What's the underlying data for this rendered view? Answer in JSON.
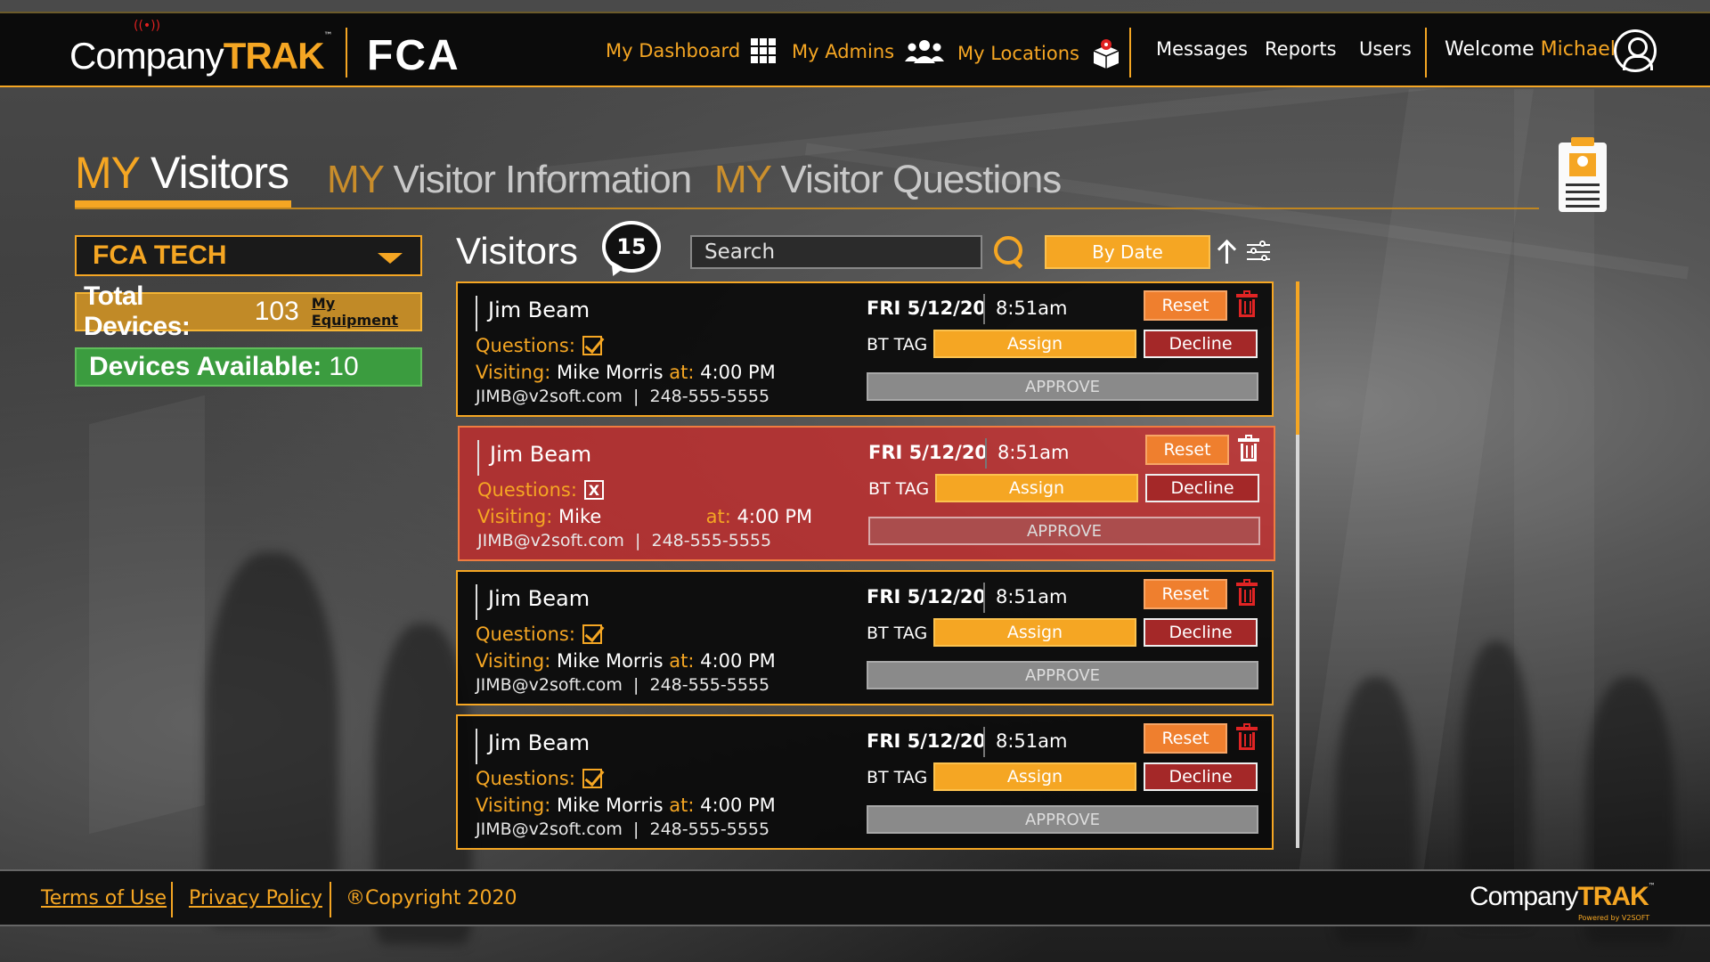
{
  "brand": {
    "company": "Company",
    "trak": "TRAK",
    "tm": "™",
    "client": "FCA"
  },
  "nav": {
    "dashboard": "My Dashboard",
    "admins": "My Admins",
    "locations": "My Locations",
    "messages": "Messages",
    "reports": "Reports",
    "users": "Users",
    "welcome": "Welcome",
    "user_name": "Michael"
  },
  "tabs": [
    {
      "my": "MY",
      "rest": " Visitors"
    },
    {
      "my": "MY",
      "rest": " Visitor Information"
    },
    {
      "my": "MY",
      "rest": " Visitor Questions"
    }
  ],
  "sidebar": {
    "location": "FCA TECH",
    "total_label": "Total Devices:",
    "total_value": "103",
    "equipment_link": "My Equipment",
    "available_label": "Devices Available:",
    "available_value": "10"
  },
  "list": {
    "title": "Visitors",
    "count": "15",
    "search_placeholder": "Search",
    "sort_label": "By Date"
  },
  "labels": {
    "questions": "Questions:",
    "visiting": "Visiting:",
    "at": "at:",
    "bt_tag": "BT TAG",
    "reset": "Reset",
    "assign": "Assign",
    "decline": "Decline",
    "approve": "APPROVE",
    "x_mark": "X"
  },
  "visitors": [
    {
      "name": "Jim Beam",
      "questions_ok": true,
      "host": "Mike Morris",
      "time": "4:00 PM",
      "email": "JIMB@v2soft.com",
      "phone": "248-555-5555",
      "date": "FRI 5/12/20",
      "checkin": "8:51am",
      "alert": false
    },
    {
      "name": "Jim Beam",
      "questions_ok": false,
      "host": "Mike",
      "time": "4:00 PM",
      "email": "JIMB@v2soft.com",
      "phone": "248-555-5555",
      "date": "FRI 5/12/20",
      "checkin": "8:51am",
      "alert": true
    },
    {
      "name": "Jim Beam",
      "questions_ok": true,
      "host": "Mike Morris",
      "time": "4:00 PM",
      "email": "JIMB@v2soft.com",
      "phone": "248-555-5555",
      "date": "FRI 5/12/20",
      "checkin": "8:51am",
      "alert": false
    },
    {
      "name": "Jim Beam",
      "questions_ok": true,
      "host": "Mike Morris",
      "time": "4:00 PM",
      "email": "JIMB@v2soft.com",
      "phone": "248-555-5555",
      "date": "FRI 5/12/20",
      "checkin": "8:51am",
      "alert": false
    }
  ],
  "footer": {
    "terms": "Terms of Use",
    "privacy": "Privacy Policy",
    "copyright": "®Copyright 2020",
    "powered": "Powered by V2SOFT"
  },
  "colors": {
    "accent": "#f5a623",
    "alert": "#d22828",
    "available": "#3b9c3f",
    "decline": "#a42828",
    "reset": "#ef7f2e"
  }
}
